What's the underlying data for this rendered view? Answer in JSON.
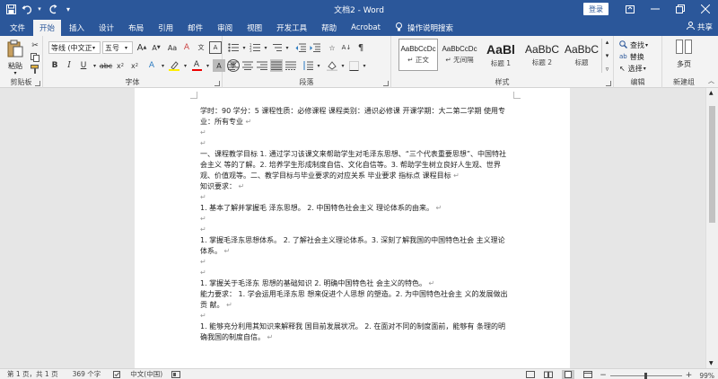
{
  "window": {
    "title": "文档2 - Word",
    "login_label": "登录"
  },
  "tabs": [
    {
      "label": "文件",
      "active": false
    },
    {
      "label": "开始",
      "active": true
    },
    {
      "label": "插入",
      "active": false
    },
    {
      "label": "设计",
      "active": false
    },
    {
      "label": "布局",
      "active": false
    },
    {
      "label": "引用",
      "active": false
    },
    {
      "label": "邮件",
      "active": false
    },
    {
      "label": "审阅",
      "active": false
    },
    {
      "label": "视图",
      "active": false
    },
    {
      "label": "开发工具",
      "active": false
    },
    {
      "label": "帮助",
      "active": false
    },
    {
      "label": "Acrobat",
      "active": false
    }
  ],
  "tell_me": "操作说明搜索",
  "share_label": "共享",
  "ribbon": {
    "clipboard": {
      "paste_label": "粘贴",
      "group_label": "剪贴板"
    },
    "font": {
      "font_name": "等线 (中文正)",
      "font_size": "五号",
      "group_label": "字体"
    },
    "paragraph": {
      "group_label": "段落"
    },
    "styles": {
      "group_label": "样式",
      "items": [
        {
          "sample": "AaBbCcDc",
          "name": "正文",
          "selected": true
        },
        {
          "sample": "AaBbCcDc",
          "name": "无间隔",
          "selected": false
        },
        {
          "sample": "AaBl",
          "name": "标题 1",
          "selected": false
        },
        {
          "sample": "AaBbC",
          "name": "标题 2",
          "selected": false
        },
        {
          "sample": "AaBbC",
          "name": "标题",
          "selected": false
        }
      ]
    },
    "editing": {
      "find_label": "查找",
      "replace_label": "替换",
      "select_label": "选择",
      "group_label": "编辑"
    },
    "newgroup": {
      "multipage_label": "多页",
      "group_label": "新建组"
    }
  },
  "document": {
    "paragraphs": [
      "学时：90 学分：5 课程性质：必修课程 课程类别：通识必修课 开课学期：大二第二学期 使用专业：所有专业",
      "",
      "",
      "一、课程教学目标 1. 通过学习该课文来帮助学生对毛泽东思想、“三个代表重要思想”、中国特社会主义 等的了解。2. 培养学生形成制度自信、文化自信等。3. 帮助学生树立良好人生观、世界观、价值观等。二、教学目标与毕业要求的对应关系 毕业要求 指标点 课程目标",
      "知识要求：",
      "",
      "1. 基本了解并掌握毛 泽东思想。 2. 中国特色社会主义 理论体系的由来。",
      "",
      "",
      "1. 掌握毛泽东思想体系。 2. 了解社会主义理论体系。3. 深刻了解我国的中国特色社会 主义理论体系。",
      "",
      "",
      "1. 掌握关于毛泽东 思想的基础知识 2. 明确中国特色社 会主义的特色。",
      "能力要求： 1. 学会运用毛泽东思 想来促进个人思想 的塑造。2. 为中国特色社会主 义的发展做出贡 献。",
      "",
      "1. 能够充分利用其知识来解释我 国目前发展状况。 2. 在面对不同的制度面前，能够有 条理的明确我国的制度自信。"
    ]
  },
  "status": {
    "page": "第 1 页，共 1 页",
    "words": "369 个字",
    "language": "中文(中国)",
    "zoom": "99%",
    "zoom_level": 0.99
  },
  "colors": {
    "accent": "#2b579a",
    "ribbon_bg": "#f3f3f3"
  }
}
